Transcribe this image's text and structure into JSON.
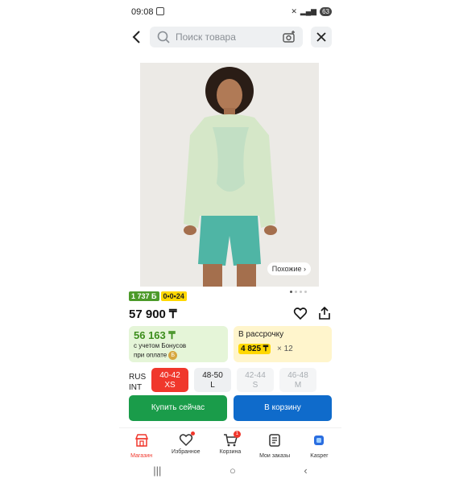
{
  "status_bar": {
    "time": "09:08",
    "battery": "63"
  },
  "search": {
    "placeholder": "Поиск товара"
  },
  "product": {
    "similar_label": "Похожие",
    "bonus_badge": "1 737 Б",
    "installment_badge": "0•0•24",
    "price": "57 900 ₸",
    "colors": {
      "hoodie": "#d5e7c8",
      "shorts": "#4fb5a5",
      "background": "#eceae6"
    }
  },
  "bonus_card": {
    "amount": "56 163 ₸",
    "line1": "с учетом Бонусов",
    "line2": "при оплате"
  },
  "installment_card": {
    "title": "В рассрочку",
    "payment": "4 825 ₸",
    "multiplier": "× 12"
  },
  "size_labels": {
    "rus": "RUS",
    "int": "INT"
  },
  "sizes": [
    {
      "rus": "40-42",
      "int": "XS",
      "state": "selected"
    },
    {
      "rus": "48-50",
      "int": "L",
      "state": "available"
    },
    {
      "rus": "42-44",
      "int": "S",
      "state": "unavailable"
    },
    {
      "rus": "46-48",
      "int": "M",
      "state": "unavailable"
    }
  ],
  "actions": {
    "buy_now": "Купить сейчас",
    "add_to_cart": "В корзину"
  },
  "nav": {
    "items": [
      {
        "label": "Магазин",
        "icon": "shop-icon",
        "active": true
      },
      {
        "label": "Избранное",
        "icon": "heart-icon"
      },
      {
        "label": "Корзина",
        "icon": "cart-icon",
        "badge": "1"
      },
      {
        "label": "Мои заказы",
        "icon": "orders-icon"
      },
      {
        "label": "Kasper",
        "icon": "kasper-icon"
      }
    ]
  },
  "accent_colors": {
    "red": "#f0372c",
    "green": "#1a9c4a",
    "blue": "#0f6bcb",
    "yellow": "#ffd800"
  }
}
